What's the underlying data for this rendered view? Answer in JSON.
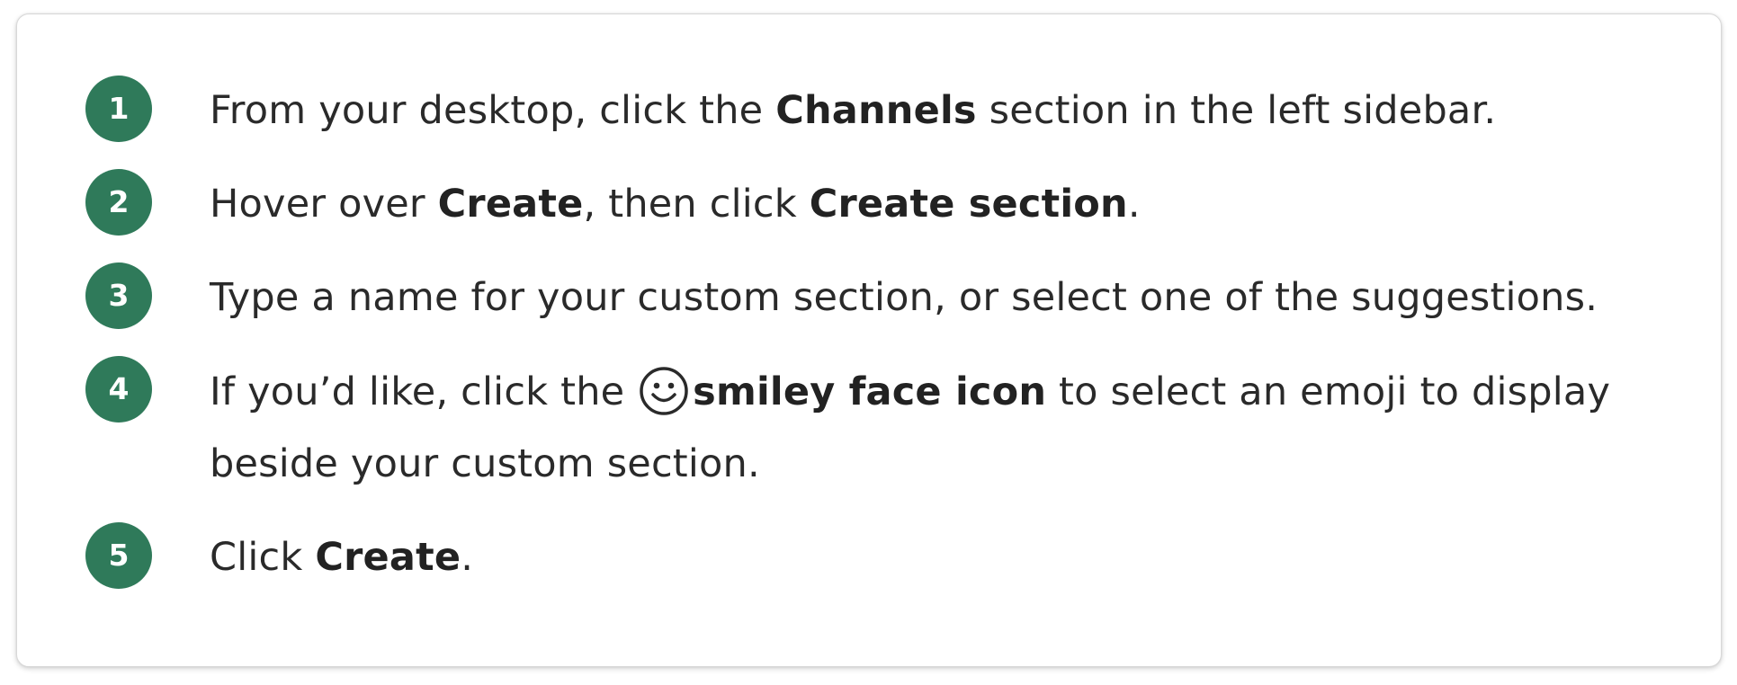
{
  "steps": [
    {
      "number": "1",
      "parts": {
        "t1": "From your desktop, click the ",
        "b1": "Channels",
        "t2": " section in the left sidebar."
      }
    },
    {
      "number": "2",
      "parts": {
        "t1": "Hover over ",
        "b1": "Create",
        "t2": ", then click ",
        "b2": "Create section",
        "t3": "."
      }
    },
    {
      "number": "3",
      "parts": {
        "t1": "Type a name for your custom section, or select one of the suggestions."
      }
    },
    {
      "number": "4",
      "parts": {
        "t1": "If you’d like, click the ",
        "icon": "smiley-face-icon",
        "b1": "smiley face icon",
        "t2": " to select an emoji to display beside your custom section."
      }
    },
    {
      "number": "5",
      "parts": {
        "t1": "Click ",
        "b1": "Create",
        "t2": "."
      }
    }
  ],
  "colors": {
    "badge": "#2f7a5a",
    "text": "#2a2a2a",
    "border": "#d8d8d8"
  }
}
